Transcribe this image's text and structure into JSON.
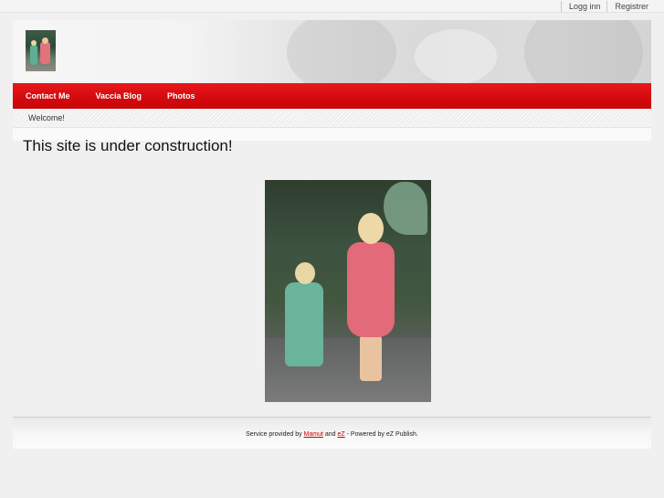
{
  "top_links": {
    "login": "Logg inn",
    "register": "Registrer"
  },
  "nav": {
    "items": [
      "Contact Me",
      "Vaccia Blog",
      "Photos"
    ]
  },
  "breadcrumb": {
    "text": "Welcome!"
  },
  "main": {
    "title": "This site is under construction!"
  },
  "footer": {
    "prefix": "Service provided by ",
    "link1": "Mamut",
    "middle": " and ",
    "link2": "eZ",
    "suffix": " - Powered by eZ Publish."
  },
  "colors": {
    "nav_red": "#d40a0e",
    "background": "#f0f0f0",
    "link_red": "#cc0000"
  },
  "icons": {
    "logo": "children-photo-thumbnail"
  }
}
